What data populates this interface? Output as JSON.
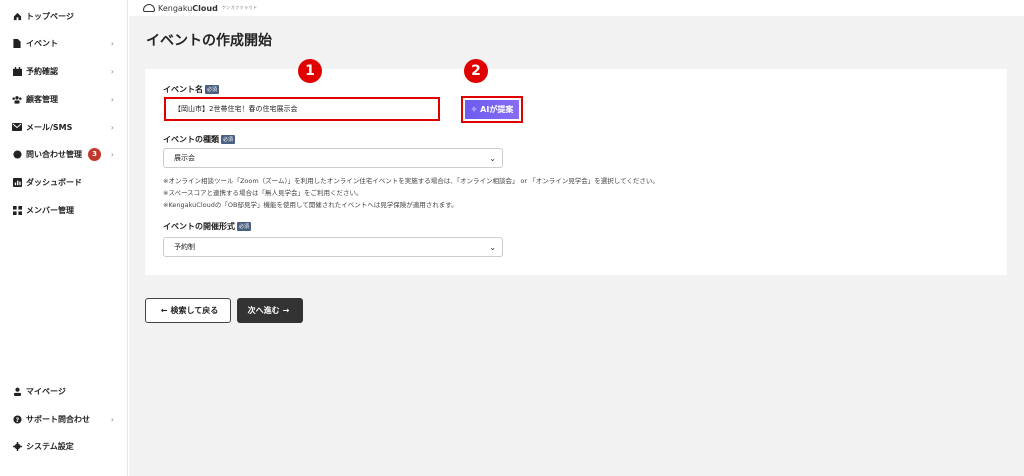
{
  "sidebar": {
    "items": [
      {
        "label": "トップページ",
        "icon": "home-icon",
        "chevron": ""
      },
      {
        "label": "イベント",
        "icon": "document-icon",
        "chevron": "›"
      },
      {
        "label": "予約確認",
        "icon": "calendar-icon",
        "chevron": "›"
      },
      {
        "label": "顧客管理",
        "icon": "users-icon",
        "chevron": "›"
      },
      {
        "label": "メール/SMS",
        "icon": "mail-icon",
        "chevron": "›"
      },
      {
        "label": "問い合わせ管理",
        "icon": "chat-icon",
        "chevron": "›",
        "badge": "3"
      },
      {
        "label": "ダッシュボード",
        "icon": "chart-icon",
        "chevron": ""
      },
      {
        "label": "メンバー管理",
        "icon": "grid-icon",
        "chevron": ""
      }
    ],
    "bottom_items": [
      {
        "label": "マイページ",
        "icon": "person-icon",
        "chevron": ""
      },
      {
        "label": "サポート問合わせ",
        "icon": "help-icon",
        "chevron": "›"
      },
      {
        "label": "システム設定",
        "icon": "gear-icon",
        "chevron": ""
      }
    ]
  },
  "topbar": {
    "brand_prefix": "Kengaku",
    "brand_bold": "Cloud",
    "brand_sub": "ケンガククラウド"
  },
  "page": {
    "title": "イベントの作成開始"
  },
  "form": {
    "required_tag": "必須",
    "event_name_label": "イベント名",
    "event_name_value": "【岡山市】2世帯住宅！春の住宅展示会",
    "ai_button_label": "✧ AIが提案",
    "event_type_label": "イベントの種類",
    "event_type_value": "展示会",
    "notes": [
      "※オンライン相談ツール「Zoom（ズーム）」を利用したオンライン住宅イベントを実施する場合は、「オンライン相談会」 or 「オンライン見学会」を選択してください。",
      "※スペースコアと連携する場合は「無人見学会」をご利用ください。",
      "※KengakuCloudの「OB邸見学」機能を使用して開催されたイベントへは見学保険が適用されます。"
    ],
    "format_label": "イベントの開催形式",
    "format_value": "予約制"
  },
  "callouts": [
    "1",
    "2"
  ],
  "buttons": {
    "back_label": "検索して戻る",
    "next_label": "次へ進む"
  },
  "colors": {
    "accent_red": "#e00000",
    "ai_gradient_start": "#6a5cf0",
    "ai_gradient_end": "#8a6cf5",
    "badge_red": "#c0392b",
    "dark_button": "#333333"
  }
}
